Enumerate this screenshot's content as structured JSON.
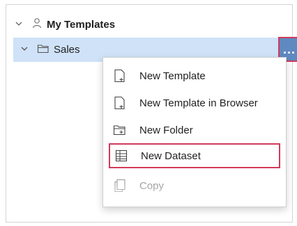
{
  "tree": {
    "root": {
      "label": "My Templates",
      "chevron_icon": "chevron-down-icon",
      "icon": "user-icon"
    },
    "sales": {
      "label": "Sales",
      "chevron_icon": "chevron-down-icon",
      "icon": "folder-icon",
      "more_label": "..."
    }
  },
  "menu": {
    "items": [
      {
        "label": "New Template",
        "icon": "new-template-icon"
      },
      {
        "label": "New Template in Browser",
        "icon": "new-template-browser-icon"
      },
      {
        "label": "New Folder",
        "icon": "new-folder-icon"
      },
      {
        "label": "New Dataset",
        "icon": "dataset-icon"
      },
      {
        "label": "Copy",
        "icon": "copy-icon"
      }
    ]
  },
  "colors": {
    "selection": "#cfe2f7",
    "more_button": "#5f89c1",
    "highlight_border": "#d13a5b"
  }
}
